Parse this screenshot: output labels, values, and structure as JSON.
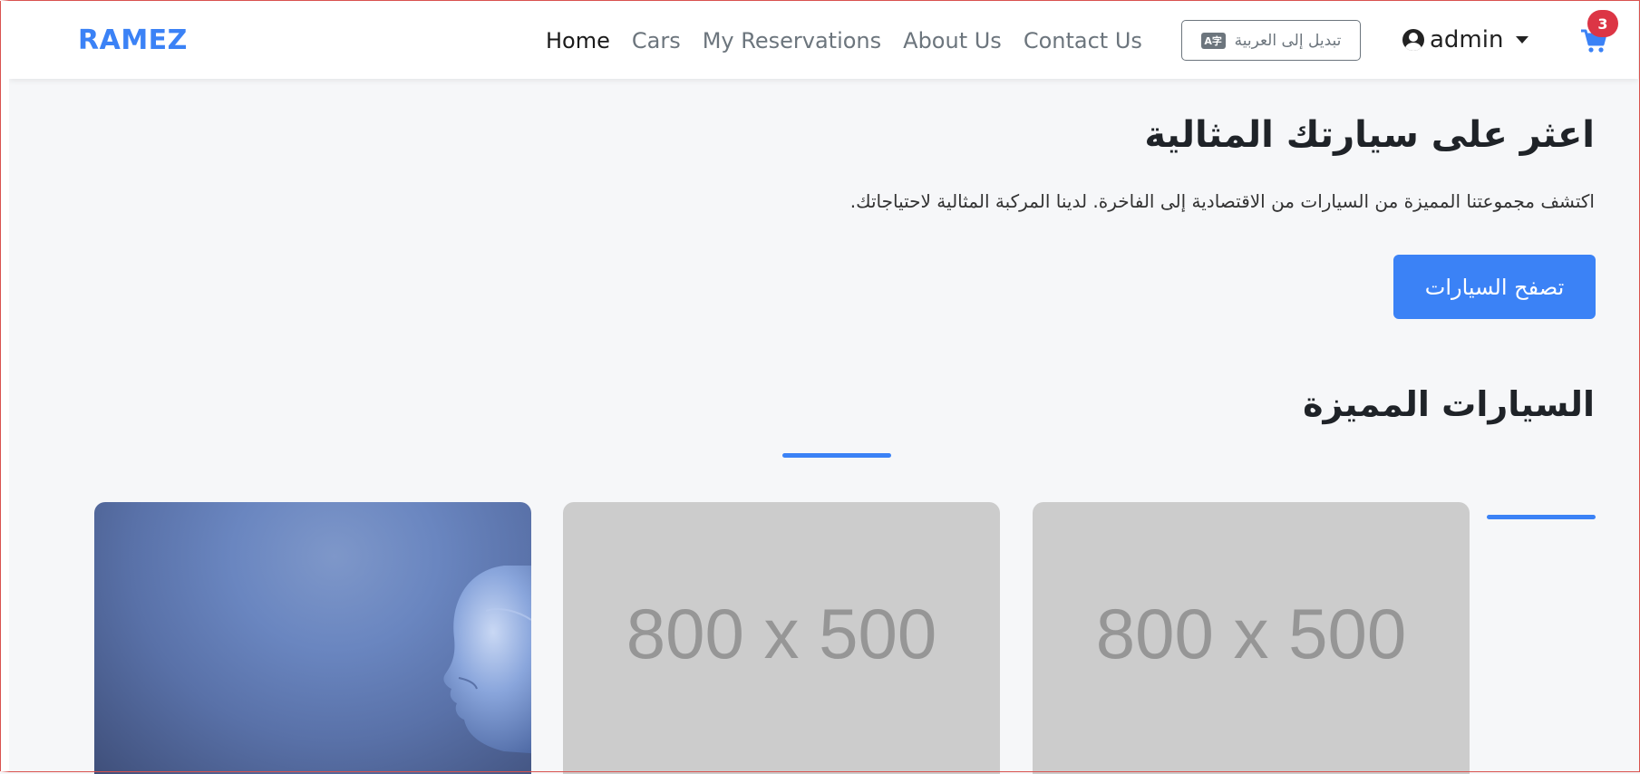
{
  "navbar": {
    "brand": "RAMEZ",
    "links": [
      "Home",
      "Cars",
      "My Reservations",
      "About Us",
      "Contact Us"
    ],
    "active_link": "Home",
    "language_button": "تبديل إلى العربية",
    "language_icon": "language-icon",
    "user_name": "admin",
    "cart_count": "3",
    "colors": {
      "brand": "#3b82f6",
      "badge": "#dc3545"
    }
  },
  "hero": {
    "title": "اعثر على سيارتك المثالية",
    "subtitle": "اكتشف مجموعتنا المميزة من السيارات من الاقتصادية إلى الفاخرة. لدينا المركبة المثالية لاحتياجاتك.",
    "button": "تصفح السيارات"
  },
  "featured": {
    "title": "السيارات المميزة",
    "cards": [
      {
        "type": "image",
        "label": ""
      },
      {
        "type": "placeholder",
        "label": "800 x 500"
      },
      {
        "type": "placeholder",
        "label": "800 x 500"
      }
    ]
  }
}
